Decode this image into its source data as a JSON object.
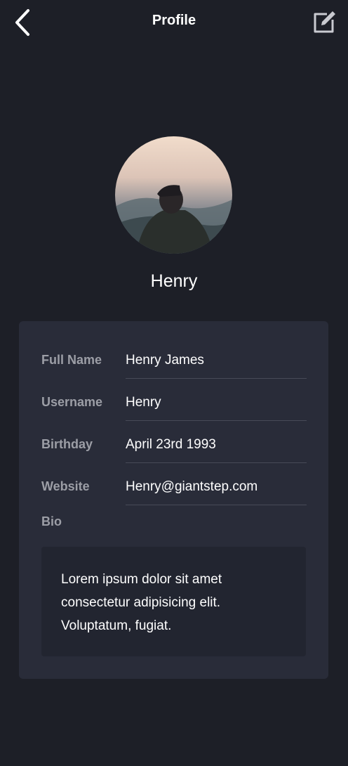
{
  "header": {
    "title": "Profile",
    "back_icon": "chevron-left-icon",
    "edit_icon": "edit-icon"
  },
  "profile": {
    "display_name": "Henry"
  },
  "fields": [
    {
      "label": "Full Name",
      "value": "Henry James"
    },
    {
      "label": "Username",
      "value": "Henry"
    },
    {
      "label": "Birthday",
      "value": "April 23rd 1993"
    },
    {
      "label": "Website",
      "value": "Henry@giantstep.com"
    }
  ],
  "bio": {
    "label": "Bio",
    "text": "Lorem ipsum dolor sit amet consectetur adipisicing elit. Voluptatum, fugiat."
  },
  "colors": {
    "background": "#1d1f27",
    "card": "#292c39",
    "bio_box": "#222530",
    "label": "#9c9ea6",
    "divider": "#474a57"
  }
}
